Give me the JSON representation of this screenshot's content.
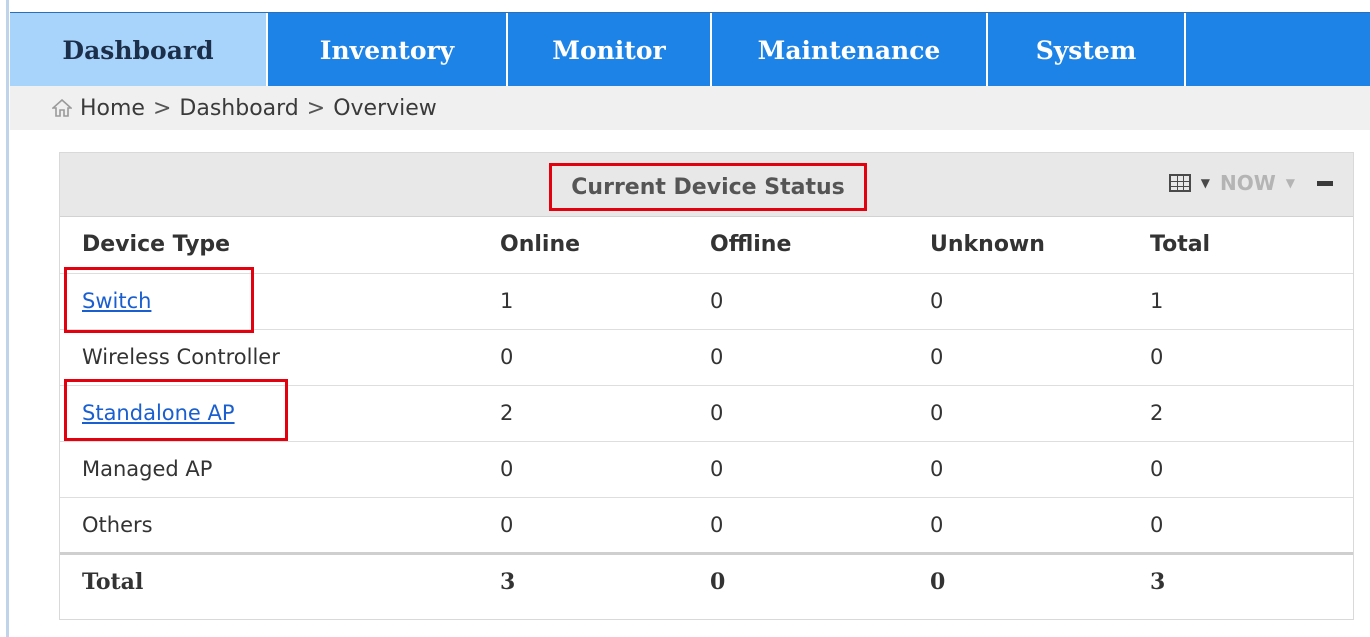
{
  "nav": {
    "tabs": [
      {
        "label": "Dashboard",
        "active": true
      },
      {
        "label": "Inventory",
        "active": false
      },
      {
        "label": "Monitor",
        "active": false
      },
      {
        "label": "Maintenance",
        "active": false
      },
      {
        "label": "System",
        "active": false
      }
    ]
  },
  "breadcrumb": {
    "icon": "home-icon",
    "items": [
      "Home",
      "Dashboard",
      "Overview"
    ],
    "separator": ">"
  },
  "panel": {
    "title": "Current Device Status",
    "tools": {
      "view_icon": "table-grid-icon",
      "range_label": "NOW",
      "collapse_icon": "minimize-icon"
    },
    "columns": [
      "Device Type",
      "Online",
      "Offline",
      "Unknown",
      "Total"
    ],
    "rows": [
      {
        "type": "Switch",
        "online": "1",
        "offline": "0",
        "unknown": "0",
        "total": "1",
        "link": true
      },
      {
        "type": "Wireless Controller",
        "online": "0",
        "offline": "0",
        "unknown": "0",
        "total": "0",
        "link": false
      },
      {
        "type": "Standalone AP",
        "online": "2",
        "offline": "0",
        "unknown": "0",
        "total": "2",
        "link": true
      },
      {
        "type": "Managed AP",
        "online": "0",
        "offline": "0",
        "unknown": "0",
        "total": "0",
        "link": false
      },
      {
        "type": "Others",
        "online": "0",
        "offline": "0",
        "unknown": "0",
        "total": "0",
        "link": false
      }
    ],
    "total_row": {
      "type": "Total",
      "online": "3",
      "offline": "0",
      "unknown": "0",
      "total": "3"
    }
  },
  "colors": {
    "tab_bar": "#1e83e6",
    "tab_active": "#a8d4fb",
    "link": "#1a5fd0",
    "highlight": "#e3000f"
  }
}
